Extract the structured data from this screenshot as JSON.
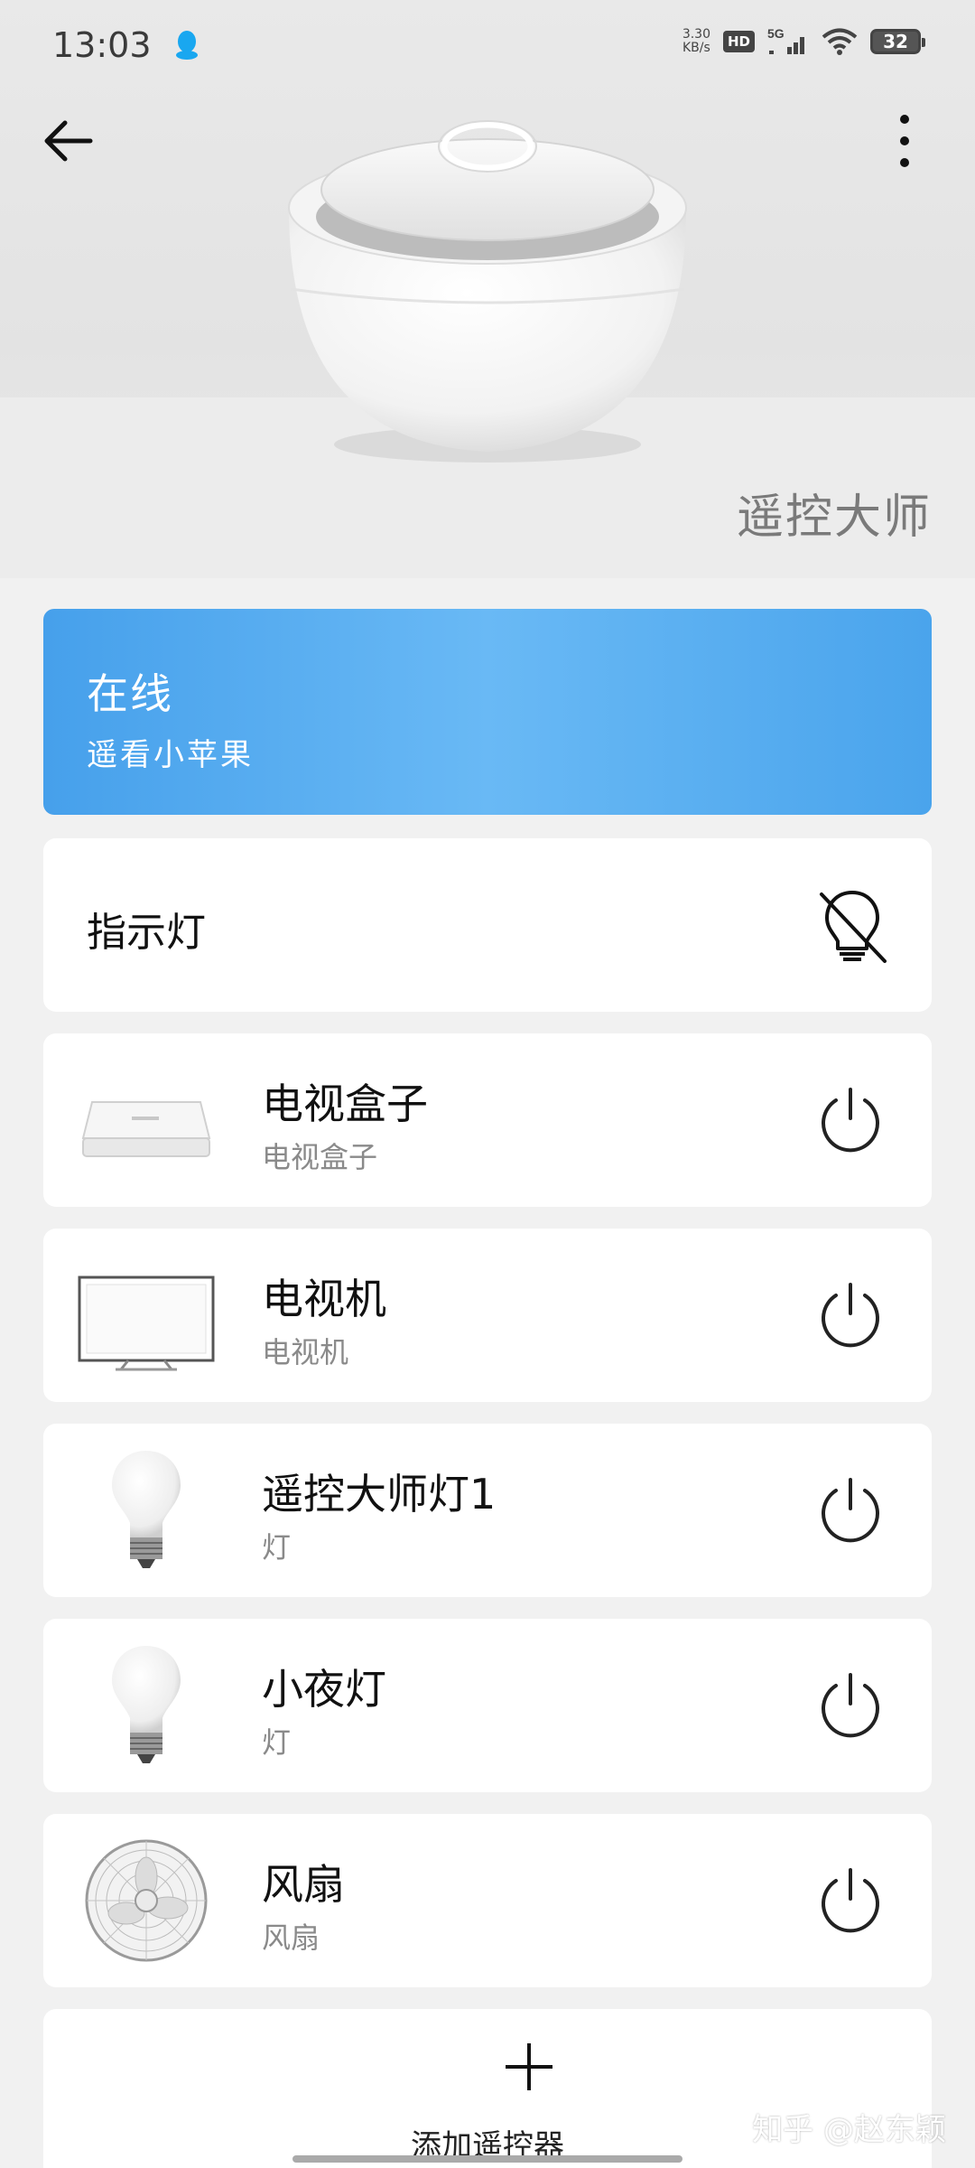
{
  "status_bar": {
    "time": "13:03",
    "speed_value": "3.30",
    "speed_unit": "KB/s",
    "hd": "HD",
    "network": "5G",
    "battery": "32"
  },
  "header": {
    "app_title": "遥控大师"
  },
  "connection": {
    "status": "在线",
    "device_name": "遥看小苹果"
  },
  "indicator": {
    "label": "指示灯",
    "icon": "bulb-off-icon"
  },
  "devices": [
    {
      "name": "电视盒子",
      "type": "电视盒子",
      "icon": "tv-box-icon"
    },
    {
      "name": "电视机",
      "type": "电视机",
      "icon": "tv-icon"
    },
    {
      "name": "遥控大师灯1",
      "type": "灯",
      "icon": "light-bulb-icon"
    },
    {
      "name": "小夜灯",
      "type": "灯",
      "icon": "light-bulb-icon"
    },
    {
      "name": "风扇",
      "type": "风扇",
      "icon": "fan-icon"
    }
  ],
  "add_remote": {
    "label": "添加遥控器"
  },
  "watermark": "知乎 @赵东颖",
  "colors": {
    "accent": "#4aa4ec",
    "background": "#f1f1f1"
  }
}
